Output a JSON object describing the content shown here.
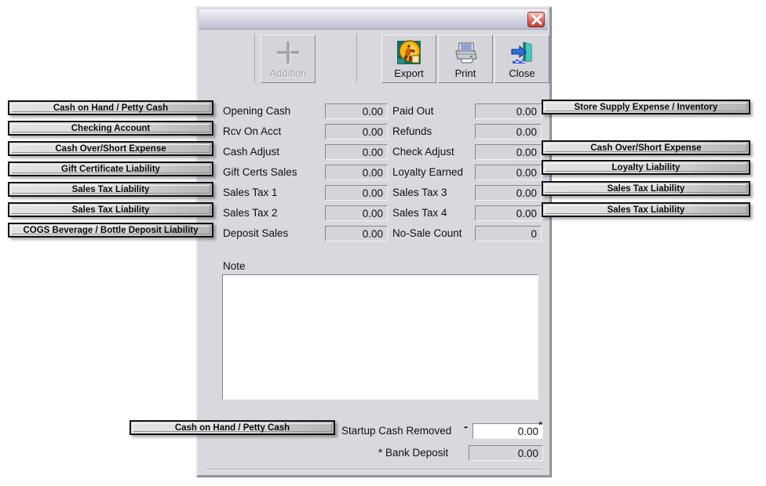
{
  "window": {
    "title": "",
    "close_tooltip": "Close"
  },
  "toolbar": {
    "buttons": [
      {
        "label": "Addition",
        "icon": "plus-icon",
        "enabled": false
      },
      {
        "label": "Export",
        "icon": "export-running-man-icon",
        "enabled": true
      },
      {
        "label": "Print",
        "icon": "printer-icon",
        "enabled": true
      },
      {
        "label": "Close",
        "icon": "exit-door-icon",
        "enabled": true
      }
    ]
  },
  "left_column": {
    "rows": [
      {
        "label": "Opening Cash",
        "value": "0.00"
      },
      {
        "label": "Rcv On Acct",
        "value": "0.00"
      },
      {
        "label": "Cash Adjust",
        "value": "0.00"
      },
      {
        "label": "Gift Certs Sales",
        "value": "0.00"
      },
      {
        "label": "Sales Tax 1",
        "value": "0.00"
      },
      {
        "label": "Sales Tax 2",
        "value": "0.00"
      },
      {
        "label": "Deposit Sales",
        "value": "0.00"
      }
    ]
  },
  "right_column": {
    "rows": [
      {
        "label": "Paid Out",
        "value": "0.00"
      },
      {
        "label": "Refunds",
        "value": "0.00"
      },
      {
        "label": "Check Adjust",
        "value": "0.00"
      },
      {
        "label": "Loyalty Earned",
        "value": "0.00"
      },
      {
        "label": "Sales Tax 3",
        "value": "0.00"
      },
      {
        "label": "Sales Tax 4",
        "value": "0.00"
      },
      {
        "label": "No-Sale Count",
        "value": "0"
      }
    ]
  },
  "left_tags": [
    {
      "label": "Cash on Hand / Petty Cash"
    },
    {
      "label": "Checking Account"
    },
    {
      "label": "Cash Over/Short Expense"
    },
    {
      "label": "Gift Certificate Liability"
    },
    {
      "label": "Sales Tax Liability"
    },
    {
      "label": "Sales Tax Liability"
    },
    {
      "label": "COGS Beverage / Bottle Deposit Liability"
    }
  ],
  "right_tags": [
    {
      "label": "Store Supply Expense / Inventory",
      "row": 0
    },
    {
      "label": "Cash Over/Short Expense",
      "row": 2
    },
    {
      "label": "Loyalty Liability",
      "row": 3
    },
    {
      "label": "Sales Tax Liability",
      "row": 4
    },
    {
      "label": "Sales Tax Liability",
      "row": 5
    }
  ],
  "note": {
    "label": "Note",
    "value": "",
    "placeholder": ""
  },
  "bottom": {
    "tag_label": "Cash on Hand / Petty Cash",
    "startup_label": "Startup Cash Removed",
    "startup_value": "0.00",
    "minus_sign": "-",
    "asterisk": "*",
    "bank_label": "* Bank Deposit",
    "bank_value": "0.00"
  },
  "colors": {
    "window_face": "#d8d8dd",
    "field_face": "#d4d4da",
    "editable_field": "#ffffff",
    "tag_border": "#111111",
    "close_red": "#c9564c"
  }
}
